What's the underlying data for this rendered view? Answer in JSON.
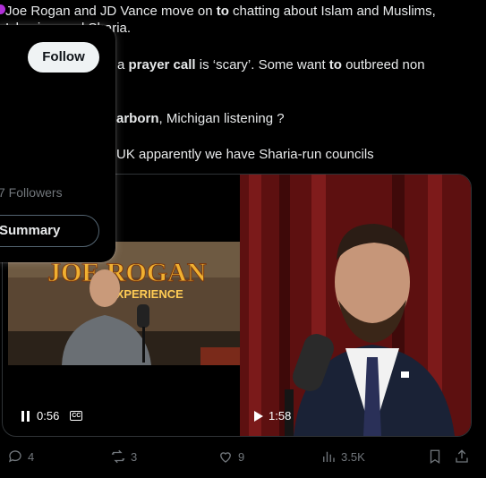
{
  "tweet": {
    "line1_a": "Joe Rogan and JD Vance move on ",
    "line1_b": "to",
    "line1_c": " chatting about Islam and Muslims,",
    "line2": "Islamism and Sharia.",
    "line3_a": "a ",
    "line3_b": "prayer call",
    "line3_c": "  is ‘scary’. Some want ",
    "line3_d": "to",
    "line3_e": " outbreed non",
    "line5_a": "arborn",
    "line5_b": ", Michigan listening ?",
    "line6": "UK apparently we have Sharia-run councils"
  },
  "hovercard": {
    "follow_label": "Follow",
    "followers_text": "7 Followers",
    "summary_label": "Summary"
  },
  "media": {
    "left_video": {
      "sign_text": "JOE ROGAN",
      "sign_sub": "EXPERIENCE",
      "time": "0:56",
      "cc_label": "CC",
      "progress": 0.0
    },
    "right_video": {
      "time": "1:58"
    }
  },
  "actions": {
    "replies": "4",
    "reposts": "3",
    "likes": "9",
    "views": "3.5K"
  },
  "colors": {
    "accent_purple": "#b02fd8",
    "muted": "#71767b",
    "text": "#e7e9ea"
  }
}
